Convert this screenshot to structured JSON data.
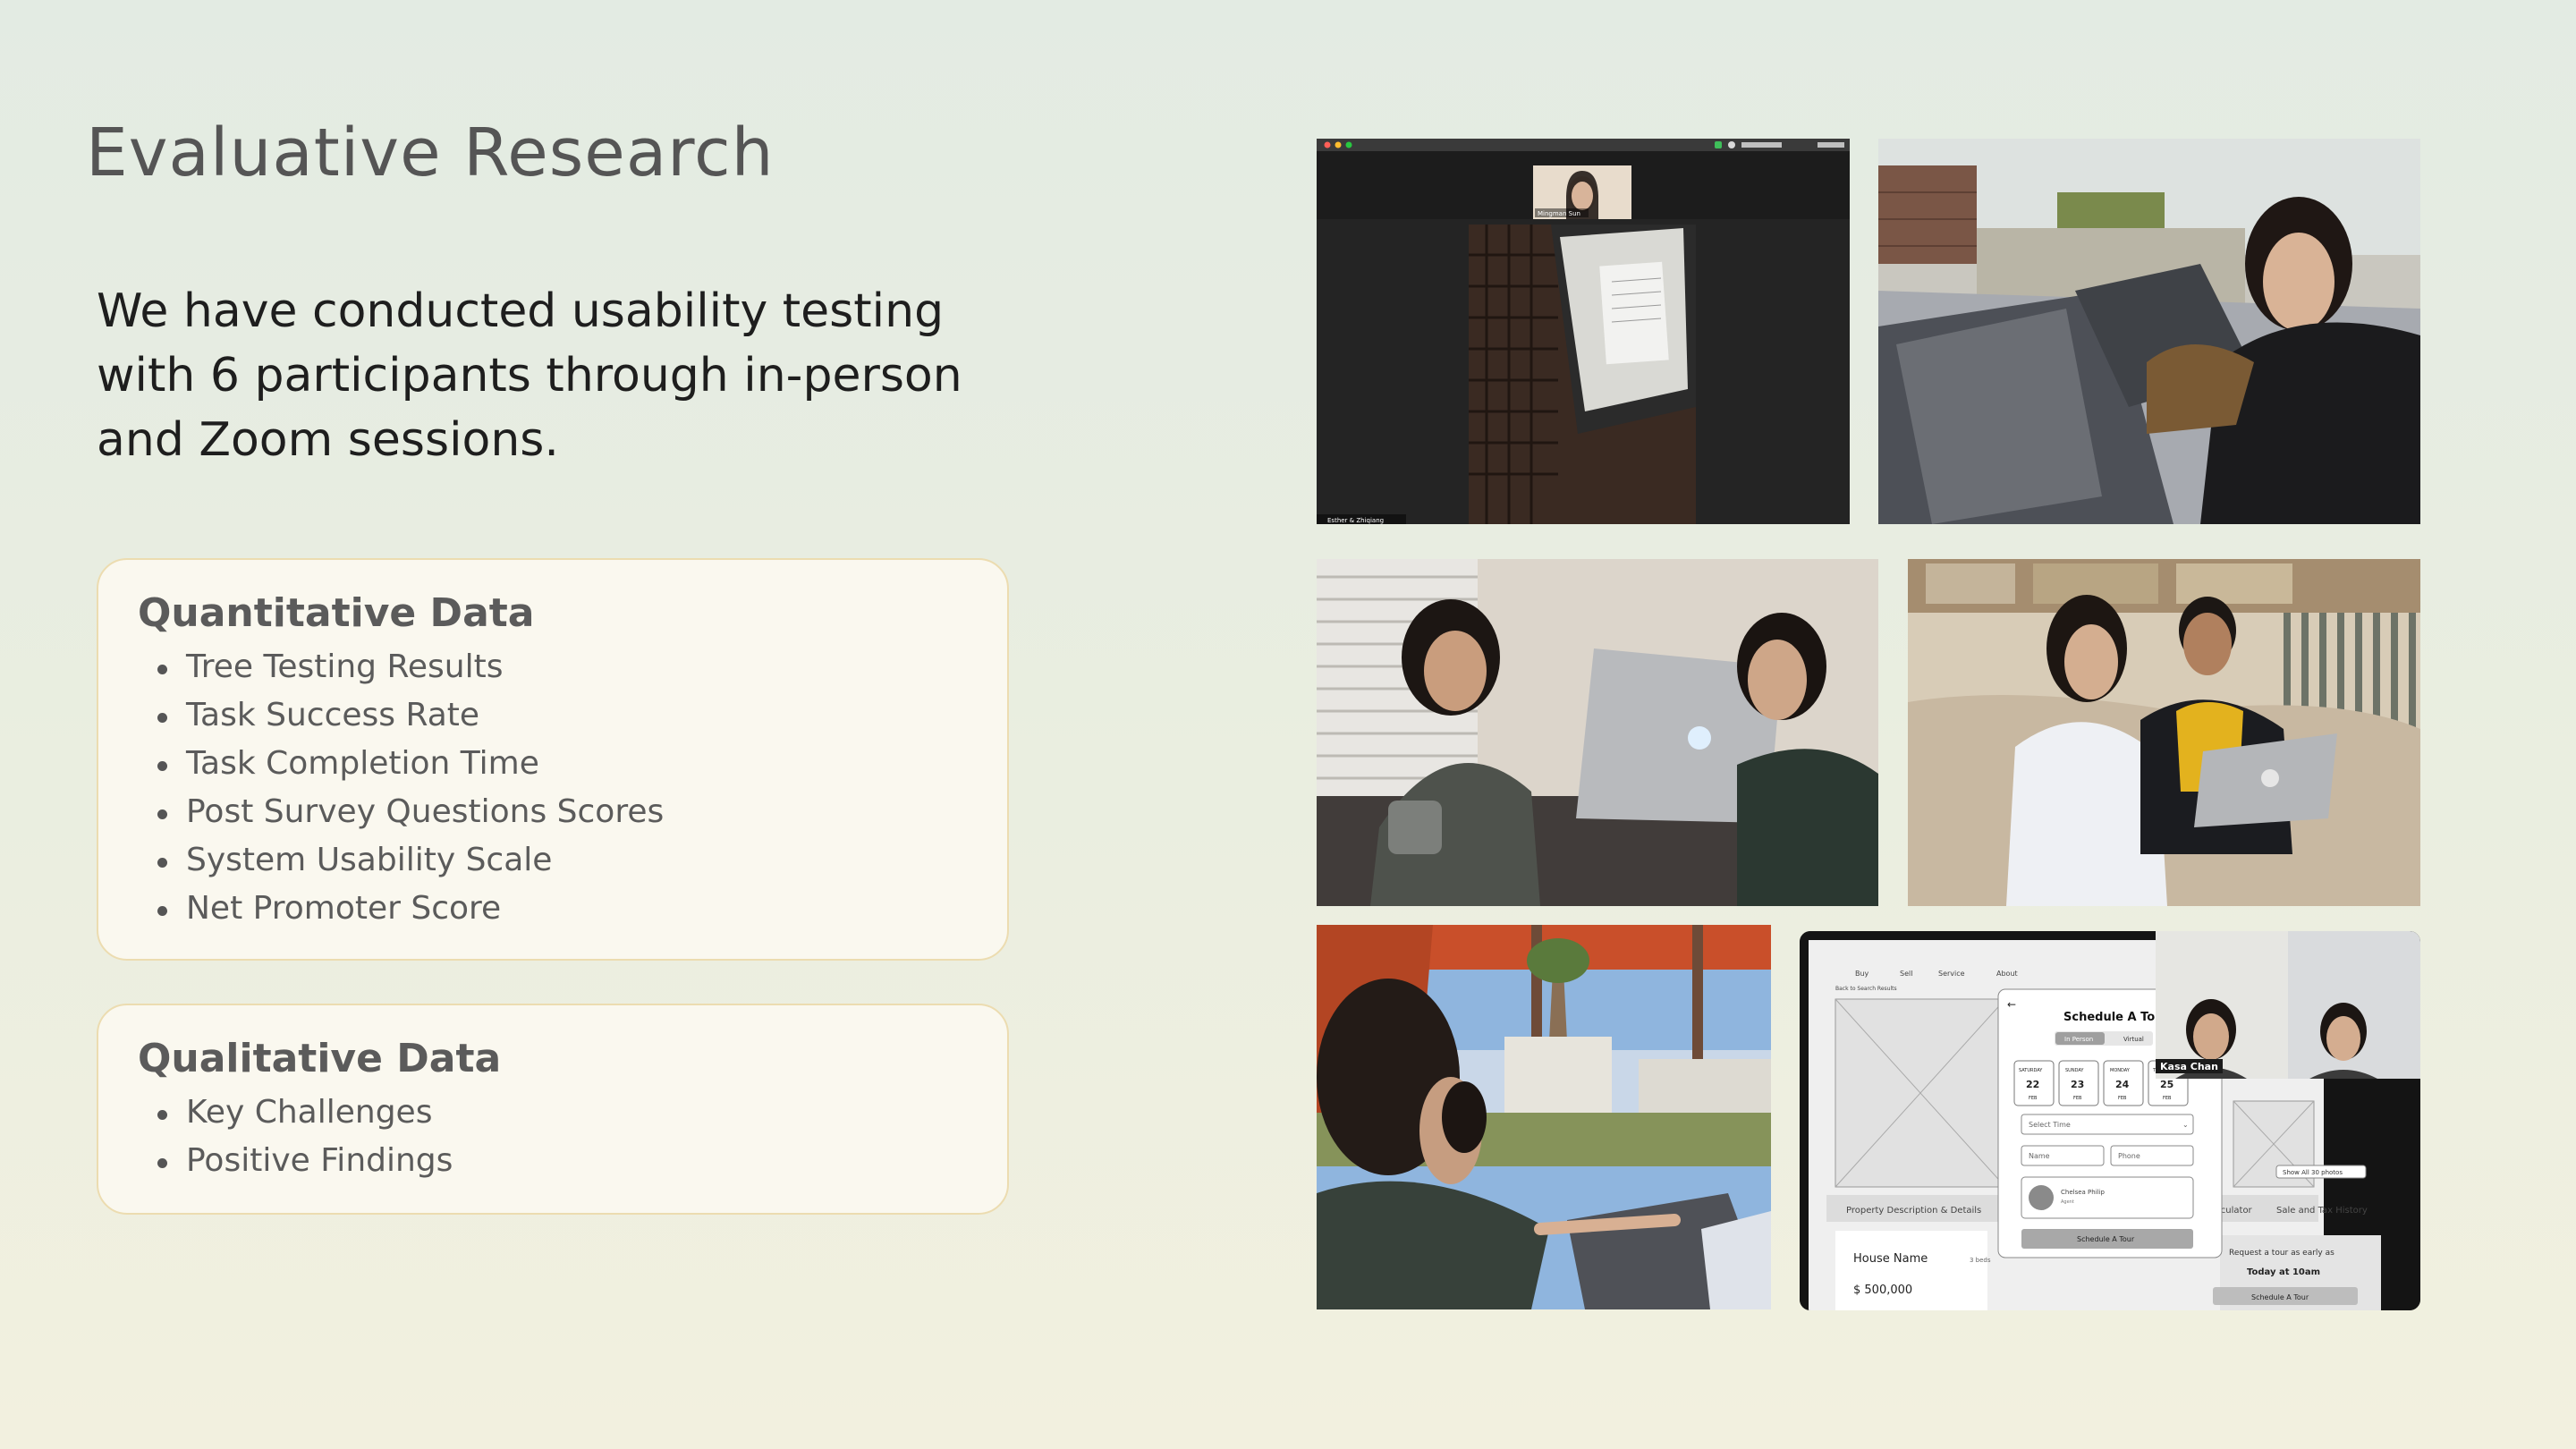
{
  "slide": {
    "title": "Evaluative Research",
    "intro": "We have conducted usability testing with 6 participants through in-person and Zoom sessions."
  },
  "quantitative": {
    "heading": "Quantitative Data",
    "items": [
      "Tree Testing Results",
      "Task Success Rate",
      "Task Completion Time",
      "Post Survey Questions Scores",
      "System Usability Scale",
      "Net Promoter Score"
    ]
  },
  "qualitative": {
    "heading": "Qualitative Data",
    "items": [
      "Key Challenges",
      "Positive Findings"
    ]
  },
  "photos": {
    "zoom_top": {
      "caption_self": "Mingman Sun",
      "caption_share": "Esther & Zhiqiang"
    },
    "zoom_bottom": {
      "speaker": "Kasa Chan",
      "nav": [
        "Buy",
        "Sell",
        "Service",
        "About"
      ],
      "back_link": "Back to Search Results",
      "modal_title": "Schedule A Tour",
      "modal_tabs": [
        "In Person",
        "Virtual"
      ],
      "dates": [
        {
          "day": "SATURDAY",
          "num": "22",
          "month": "FEB"
        },
        {
          "day": "SUNDAY",
          "num": "23",
          "month": "FEB"
        },
        {
          "day": "MONDAY",
          "num": "24",
          "month": "FEB"
        },
        {
          "day": "TUESDAY",
          "num": "25",
          "month": "FEB"
        }
      ],
      "select_time": "Select Time",
      "name_field": "Name",
      "phone_field": "Phone",
      "agent_name": "Chelsea Philip",
      "agent_role": "Agent",
      "modal_button": "Schedule A Tour",
      "show_photos": "Show All 30 photos",
      "tab_left": "Property Description & Details",
      "tab_calc": "lculator",
      "tab_history": "Sale and Tax History",
      "house_name": "House Name",
      "beds": "3 beds",
      "price": "$ 500,000",
      "request_text": "Request a tour as early as",
      "request_time": "Today at 10am",
      "side_button": "Schedule A Tour"
    }
  },
  "colors": {
    "title": "#555555",
    "card_bg": "#faf8ef",
    "card_border": "#ecdcb0",
    "laptop_silver": "#b8babd",
    "yellow_shirt": "#e3b21e"
  }
}
